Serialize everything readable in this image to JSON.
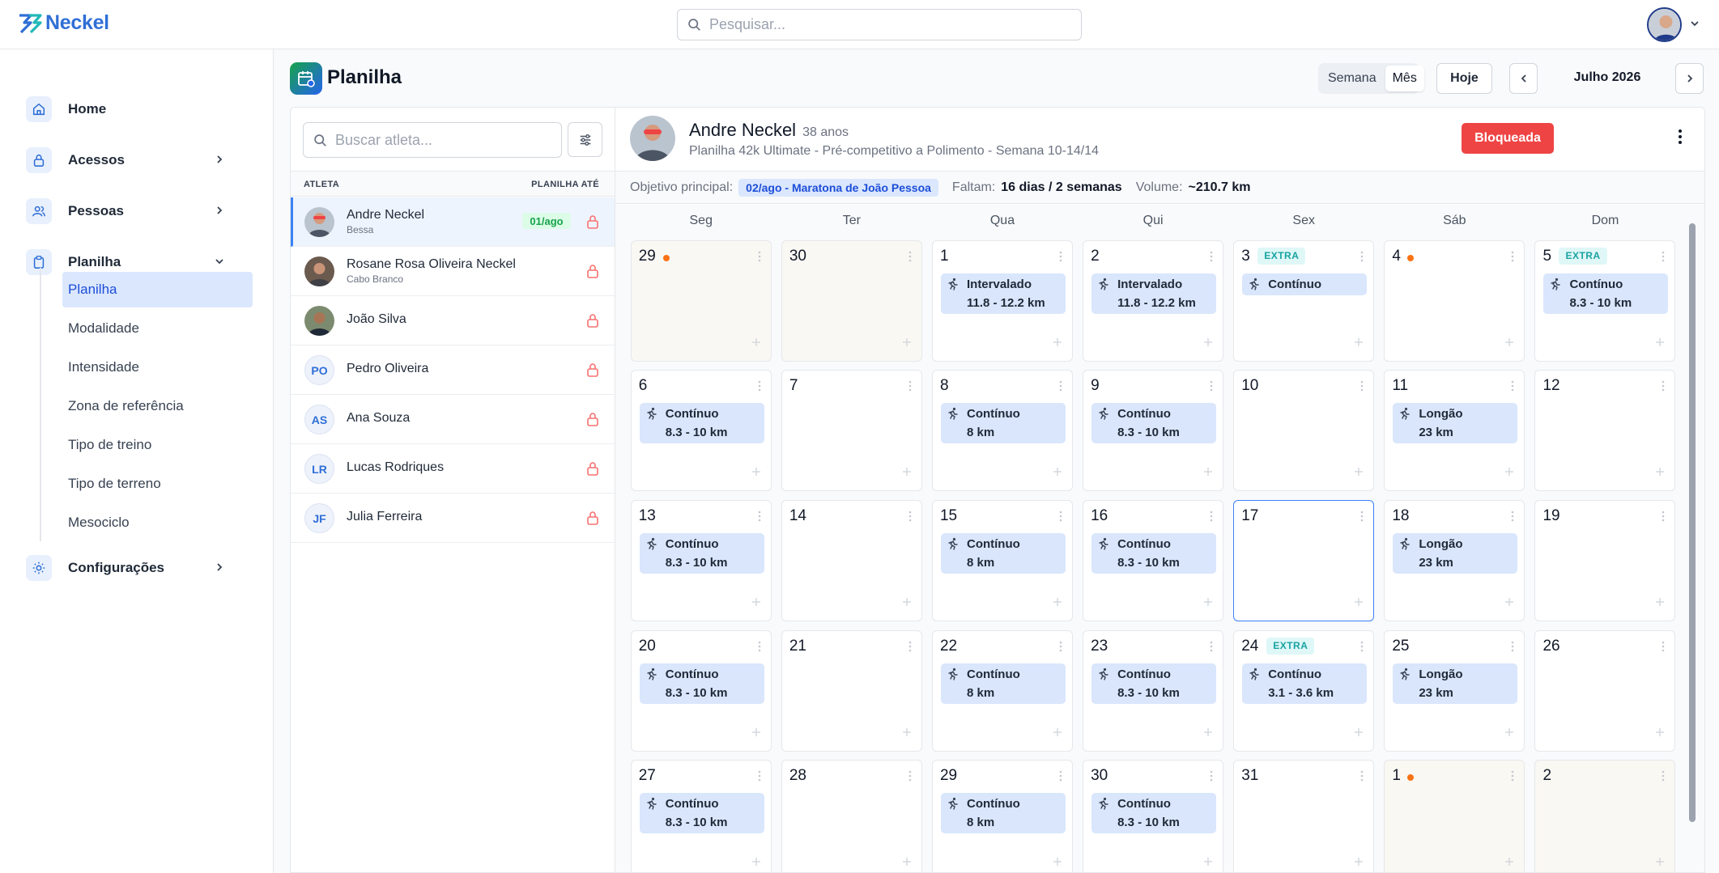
{
  "app": {
    "brand": "Neckel"
  },
  "topbar": {
    "search_placeholder": "Pesquisar..."
  },
  "sidebar": {
    "items": [
      {
        "label": "Home",
        "icon": "home-icon"
      },
      {
        "label": "Acessos",
        "icon": "lock-icon"
      },
      {
        "label": "Pessoas",
        "icon": "users-icon"
      },
      {
        "label": "Planilha",
        "icon": "clipboard-icon"
      },
      {
        "label": "Configurações",
        "icon": "gear-icon"
      }
    ],
    "sub_items": [
      {
        "label": "Planilha",
        "active": true
      },
      {
        "label": "Modalidade"
      },
      {
        "label": "Intensidade"
      },
      {
        "label": "Zona de referência"
      },
      {
        "label": "Tipo de treino"
      },
      {
        "label": "Tipo de terreno"
      },
      {
        "label": "Mesociclo"
      }
    ]
  },
  "page": {
    "title": "Planilha",
    "view_week": "Semana",
    "view_month": "Mês",
    "today": "Hoje",
    "month": "Julho 2026"
  },
  "athletes": {
    "search_placeholder": "Buscar atleta...",
    "col_athlete": "ATLETA",
    "col_until": "PLANILHA ATÉ",
    "list": [
      {
        "name": "Andre Neckel",
        "sub": "Bessa",
        "badge": "01/ago",
        "avatar": "photo"
      },
      {
        "name": "Rosane Rosa Oliveira Neckel",
        "sub": "Cabo Branco",
        "avatar": "photo"
      },
      {
        "name": "João Silva",
        "avatar": "photo"
      },
      {
        "name": "Pedro Oliveira",
        "initials": "PO"
      },
      {
        "name": "Ana Souza",
        "initials": "AS"
      },
      {
        "name": "Lucas Rodriques",
        "initials": "LR"
      },
      {
        "name": "Julia Ferreira",
        "initials": "JF"
      }
    ]
  },
  "detail": {
    "name": "Andre Neckel",
    "age": "38 anos",
    "plan": "Planilha 42k Ultimate - Pré-competitivo a Polimento - Semana 10-14/14",
    "status": "Bloqueada",
    "goal_label": "Objetivo principal:",
    "goal": "02/ago - Maratona de João Pessoa",
    "remaining_label": "Faltam:",
    "remaining": "16 dias / 2 semanas",
    "volume_label": "Volume:",
    "volume": "~210.7 km"
  },
  "calendar": {
    "weekdays": [
      "Seg",
      "Ter",
      "Qua",
      "Qui",
      "Sex",
      "Sáb",
      "Dom"
    ],
    "weeks": [
      [
        {
          "day": "29",
          "out": true,
          "dot": true
        },
        {
          "day": "30",
          "out": true
        },
        {
          "day": "1",
          "type": "Intervalado",
          "dist": "11.8 - 12.2 km"
        },
        {
          "day": "2",
          "type": "Intervalado",
          "dist": "11.8 - 12.2 km"
        },
        {
          "day": "3",
          "extra": "EXTRA",
          "type": "Contínuo"
        },
        {
          "day": "4",
          "dot": true
        },
        {
          "day": "5",
          "extra": "EXTRA",
          "type": "Contínuo",
          "dist": "8.3 - 10 km"
        }
      ],
      [
        {
          "day": "6",
          "type": "Contínuo",
          "dist": "8.3 - 10 km"
        },
        {
          "day": "7"
        },
        {
          "day": "8",
          "type": "Contínuo",
          "dist": "8 km"
        },
        {
          "day": "9",
          "type": "Contínuo",
          "dist": "8.3 - 10 km"
        },
        {
          "day": "10"
        },
        {
          "day": "11",
          "type": "Longão",
          "dist": "23 km"
        },
        {
          "day": "12"
        }
      ],
      [
        {
          "day": "13",
          "type": "Contínuo",
          "dist": "8.3 - 10 km"
        },
        {
          "day": "14"
        },
        {
          "day": "15",
          "type": "Contínuo",
          "dist": "8 km"
        },
        {
          "day": "16",
          "type": "Contínuo",
          "dist": "8.3 - 10 km"
        },
        {
          "day": "17",
          "today": true
        },
        {
          "day": "18",
          "type": "Longão",
          "dist": "23 km"
        },
        {
          "day": "19"
        }
      ],
      [
        {
          "day": "20",
          "type": "Contínuo",
          "dist": "8.3 - 10 km"
        },
        {
          "day": "21"
        },
        {
          "day": "22",
          "type": "Contínuo",
          "dist": "8 km"
        },
        {
          "day": "23",
          "type": "Contínuo",
          "dist": "8.3 - 10 km"
        },
        {
          "day": "24",
          "extra": "EXTRA",
          "type": "Contínuo",
          "dist": "3.1 - 3.6 km"
        },
        {
          "day": "25",
          "type": "Longão",
          "dist": "23 km"
        },
        {
          "day": "26"
        }
      ],
      [
        {
          "day": "27",
          "type": "Contínuo",
          "dist": "8.3 - 10 km"
        },
        {
          "day": "28"
        },
        {
          "day": "29",
          "type": "Contínuo",
          "dist": "8 km"
        },
        {
          "day": "30",
          "type": "Contínuo",
          "dist": "8.3 - 10 km"
        },
        {
          "day": "31"
        },
        {
          "day": "1",
          "out": true,
          "dot": true
        },
        {
          "day": "2",
          "out": true
        }
      ]
    ]
  },
  "colors": {
    "accent": "#2f6fd6",
    "workout_bg": "#d9e6fc",
    "extra": "#1aa3a3",
    "status": "#ef4444",
    "dot": "#f97316"
  }
}
